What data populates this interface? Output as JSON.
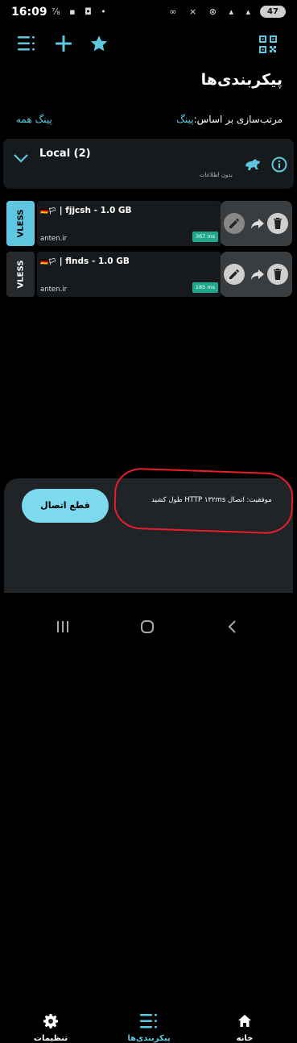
{
  "status_bar": {
    "time": "16:09",
    "left_icons": "⅞ ▪ ◘ •",
    "right_icons": "∞ ⨯ ⊗ ▴ ▴",
    "battery": "47"
  },
  "app_bar": {
    "icons": [
      "menu-icon",
      "add-icon",
      "star-icon",
      "qr-code-icon"
    ],
    "accent_color": "#5ec6df"
  },
  "page": {
    "title": "پیکربندی‌ها",
    "sort_label": "مرتب‌سازی بر اساس:",
    "sort_value": "پینگ",
    "ping_all": "پینگ همه"
  },
  "group": {
    "name": "Local (2)",
    "info": "بدون اطلاعات"
  },
  "servers": [
    {
      "protocol": "VLESS",
      "flags": "🇩🇪🏳",
      "name": "| fjjcsh - 1.0 GB",
      "host": "anten.ir",
      "ping": "367 ms",
      "selected": true
    },
    {
      "protocol": "VLESS",
      "flags": "🇩🇪🏳",
      "name": "| flnds - 1.0 GB",
      "host": "anten.ir",
      "ping": "185 ms",
      "selected": false
    }
  ],
  "bottom": {
    "disconnect_label": "قطع اتصال",
    "status_message": "موفقیت: اتصال HTTP ۱۳۲ms طول کشید",
    "nav": [
      {
        "label": "تنظیمات",
        "icon": "gear-icon"
      },
      {
        "label": "پیکربندی‌ها",
        "icon": "list-icon",
        "active": true
      },
      {
        "label": "خانه",
        "icon": "home-icon"
      }
    ]
  }
}
